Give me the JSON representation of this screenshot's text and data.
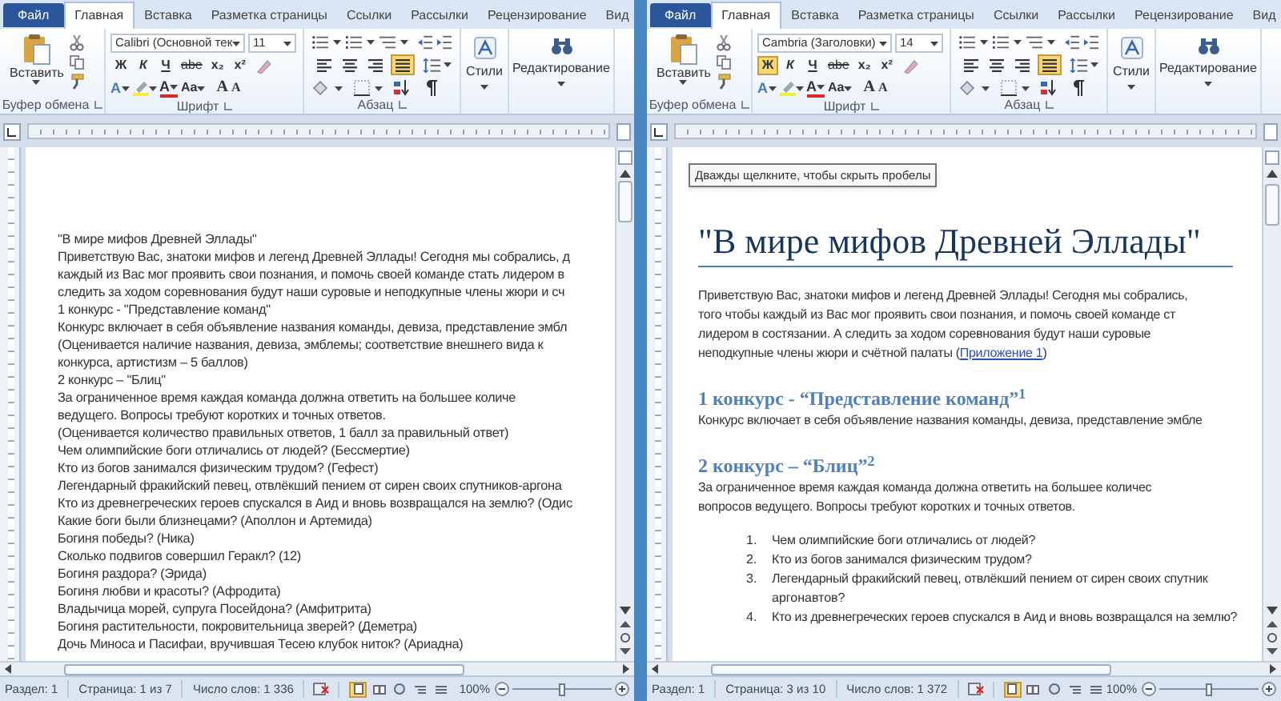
{
  "windows": [
    {
      "tabs": [
        {
          "label": "Файл",
          "kind": "file",
          "selected": false
        },
        {
          "label": "Главная",
          "kind": "tab",
          "selected": true
        },
        {
          "label": "Вставка",
          "kind": "tab",
          "selected": false
        },
        {
          "label": "Разметка страницы",
          "kind": "tab",
          "selected": false
        },
        {
          "label": "Ссылки",
          "kind": "tab",
          "selected": false
        },
        {
          "label": "Рассылки",
          "kind": "tab",
          "selected": false
        },
        {
          "label": "Рецензирование",
          "kind": "tab",
          "selected": false
        },
        {
          "label": "Вид",
          "kind": "tab",
          "selected": false
        }
      ],
      "ribbon": {
        "paste_label": "Вставить",
        "clipboard_label": "Буфер обмена",
        "font_name": "Calibri (Основной тек",
        "font_size": "11",
        "format_buttons": [
          {
            "label": "Ж",
            "kind": "bold",
            "selected": false
          },
          {
            "label": "К",
            "kind": "italic",
            "selected": false
          },
          {
            "label": "Ч",
            "kind": "underline",
            "selected": false
          },
          {
            "label": "abe",
            "kind": "strike",
            "selected": false
          },
          {
            "label": "x₂",
            "kind": "sub",
            "selected": false
          },
          {
            "label": "x²",
            "kind": "sup",
            "selected": false
          }
        ],
        "effects_label": "A",
        "font_color_label": "A",
        "case_label": "Aa",
        "grow_label": "A",
        "shrink_label": "A",
        "font_group_label": "Шрифт",
        "paragraph_buttons": [
          {
            "kind": "align-left",
            "selected": false
          },
          {
            "kind": "align-center",
            "selected": false
          },
          {
            "kind": "align-right",
            "selected": false
          },
          {
            "kind": "justify",
            "selected": true
          }
        ],
        "paragraph_group_label": "Абзац",
        "styles_label": "Стили",
        "editing_label": "Редактирование"
      },
      "document": {
        "blocks": [
          {
            "kind": "line",
            "text": "\"В мире мифов Древней Эллады\""
          },
          {
            "kind": "line",
            "text": "Приветствую Вас, знатоки мифов и легенд Древней Эллады! Сегодня мы собрались, д"
          },
          {
            "kind": "line",
            "text": "каждый из Вас мог проявить свои познания, и помочь своей команде стать лидером в"
          },
          {
            "kind": "line",
            "text": "следить за ходом соревнования будут наши суровые и неподкупные члены жюри и сч"
          },
          {
            "kind": "line",
            "text": "1 конкурс - \"Представление команд\""
          },
          {
            "kind": "line",
            "text": "Конкурс включает в себя объявление названия команды, девиза, представление эмбл"
          },
          {
            "kind": "line",
            "text": "(Оценивается наличие названия, девиза, эмблемы; соответствие внешнего вида к"
          },
          {
            "kind": "line",
            "text": "конкурса, артистизм – 5 баллов)"
          },
          {
            "kind": "line",
            "text": "2 конкурс – \"Блиц\""
          },
          {
            "kind": "line",
            "text": "За ограниченное время каждая команда должна ответить на большее количе"
          },
          {
            "kind": "line",
            "text": "ведущего. Вопросы требуют коротких и точных ответов."
          },
          {
            "kind": "line",
            "text": "(Оценивается количество правильных ответов, 1 балл за правильный ответ)"
          },
          {
            "kind": "line",
            "text": "Чем олимпийские боги отличались от людей? (Бессмертие)"
          },
          {
            "kind": "line",
            "text": "Кто из богов занимался физическим трудом? (Гефест)"
          },
          {
            "kind": "line",
            "text": "Легендарный фракийский певец, отвлёкший пением от сирен своих спутников-аргона"
          },
          {
            "kind": "line",
            "text": "Кто из древнегреческих героев спускался в Аид и вновь возвращался на землю? (Одис"
          },
          {
            "kind": "line",
            "text": "Какие боги были близнецами? (Аполлон и Артемида)"
          },
          {
            "kind": "line",
            "text": "Богиня победы? (Ника)"
          },
          {
            "kind": "line",
            "text": "Сколько подвигов совершил Геракл? (12)"
          },
          {
            "kind": "line",
            "text": "Богиня раздора? (Эрида)"
          },
          {
            "kind": "line",
            "text": "Богиня любви и красоты? (Афродита)"
          },
          {
            "kind": "line",
            "text": "Владычица морей, супруга Посейдона? (Амфитрита)"
          },
          {
            "kind": "line",
            "text": "Богиня растительности, покровительница зверей? (Деметра)"
          },
          {
            "kind": "line",
            "text": "Дочь Миноса и Пасифаи, вручившая Тесею клубок ниток? (Ариадна)"
          }
        ]
      },
      "status_bar": {
        "section": "Раздел: 1",
        "page": "Страница: 1 из 7",
        "words": "Число слов: 1 336",
        "views": [
          {
            "kind": "print",
            "selected": true
          },
          {
            "kind": "reading",
            "selected": false
          },
          {
            "kind": "web",
            "selected": false
          },
          {
            "kind": "outline",
            "selected": false
          },
          {
            "kind": "draft",
            "selected": false
          }
        ],
        "zoom": {
          "reading": "100%",
          "level": 0.5
        }
      }
    },
    {
      "tabs": [
        {
          "label": "Файл",
          "kind": "file",
          "selected": false
        },
        {
          "label": "Главная",
          "kind": "tab",
          "selected": true
        },
        {
          "label": "Вставка",
          "kind": "tab",
          "selected": false
        },
        {
          "label": "Разметка страницы",
          "kind": "tab",
          "selected": false
        },
        {
          "label": "Ссылки",
          "kind": "tab",
          "selected": false
        },
        {
          "label": "Рассылки",
          "kind": "tab",
          "selected": false
        },
        {
          "label": "Рецензирование",
          "kind": "tab",
          "selected": false
        },
        {
          "label": "Вид",
          "kind": "tab",
          "selected": false
        }
      ],
      "ribbon": {
        "paste_label": "Вставить",
        "clipboard_label": "Буфер обмена",
        "font_name": "Cambria (Заголовки)",
        "font_size": "14",
        "format_buttons": [
          {
            "label": "Ж",
            "kind": "bold",
            "selected": true
          },
          {
            "label": "К",
            "kind": "italic",
            "selected": false
          },
          {
            "label": "Ч",
            "kind": "underline",
            "selected": false
          },
          {
            "label": "abe",
            "kind": "strike",
            "selected": false
          },
          {
            "label": "x₂",
            "kind": "sub",
            "selected": false
          },
          {
            "label": "x²",
            "kind": "sup",
            "selected": false
          }
        ],
        "effects_label": "A",
        "font_color_label": "A",
        "case_label": "Aa",
        "grow_label": "A",
        "shrink_label": "A",
        "font_group_label": "Шрифт",
        "paragraph_buttons": [
          {
            "kind": "align-left",
            "selected": false
          },
          {
            "kind": "align-center",
            "selected": false
          },
          {
            "kind": "align-right",
            "selected": false
          },
          {
            "kind": "justify",
            "selected": true
          }
        ],
        "paragraph_group_label": "Абзац",
        "styles_label": "Стили",
        "editing_label": "Редактирование"
      },
      "tooltip": "Дважды щелкните, чтобы скрыть пробелы",
      "document": {
        "blocks": [
          {
            "kind": "title",
            "text": "\"В мире мифов Древней Эллады\""
          },
          {
            "kind": "line",
            "text": "Приветствую Вас, знатоки мифов и легенд Древней Эллады! Сегодня мы собрались,"
          },
          {
            "kind": "line",
            "text": "того чтобы каждый из Вас мог проявить свои познания, и помочь своей команде ст"
          },
          {
            "kind": "line",
            "text": "лидером в состязании. А следить за ходом соревнования будут наши суровые"
          },
          {
            "kind": "link-line",
            "text": "неподкупные члены жюри и счётной палаты (",
            "link": "Приложение 1",
            "after": ")"
          },
          {
            "kind": "heading",
            "text": "1 конкурс - “Представление команд”$^{1}$"
          },
          {
            "kind": "line",
            "text": "Конкурс включает в себя объявление названия команды, девиза, представление эмбле"
          },
          {
            "kind": "heading",
            "text": "2 конкурс – “Блиц”$^{2}$"
          },
          {
            "kind": "line",
            "text": "За ограниченное время каждая команда должна ответить на большее количес"
          },
          {
            "kind": "line",
            "text": "вопросов ведущего. Вопросы требуют коротких и точных ответов."
          },
          {
            "kind": "item",
            "number": "1.",
            "text": "Чем олимпийские боги отличались от людей?"
          },
          {
            "kind": "item",
            "number": "2.",
            "text": "Кто из богов занимался физическим трудом?"
          },
          {
            "kind": "item",
            "number": "3.",
            "text": "Легендарный фракийский певец, отвлёкший пением от сирен своих спутник"
          },
          {
            "kind": "continuation",
            "text": "аргонавтов?"
          },
          {
            "kind": "item",
            "number": "4.",
            "text": "Кто из древнегреческих героев спускался в Аид и вновь возвращался на землю?"
          }
        ]
      },
      "status_bar": {
        "section": "Раздел: 1",
        "page": "Страница: 3 из 10",
        "words": "Число слов: 1 372",
        "views": [
          {
            "kind": "print",
            "selected": true
          },
          {
            "kind": "reading",
            "selected": false
          },
          {
            "kind": "web",
            "selected": false
          },
          {
            "kind": "outline",
            "selected": false
          },
          {
            "kind": "draft",
            "selected": false
          }
        ],
        "zoom": {
          "reading": "100%",
          "level": 0.5
        }
      }
    }
  ]
}
